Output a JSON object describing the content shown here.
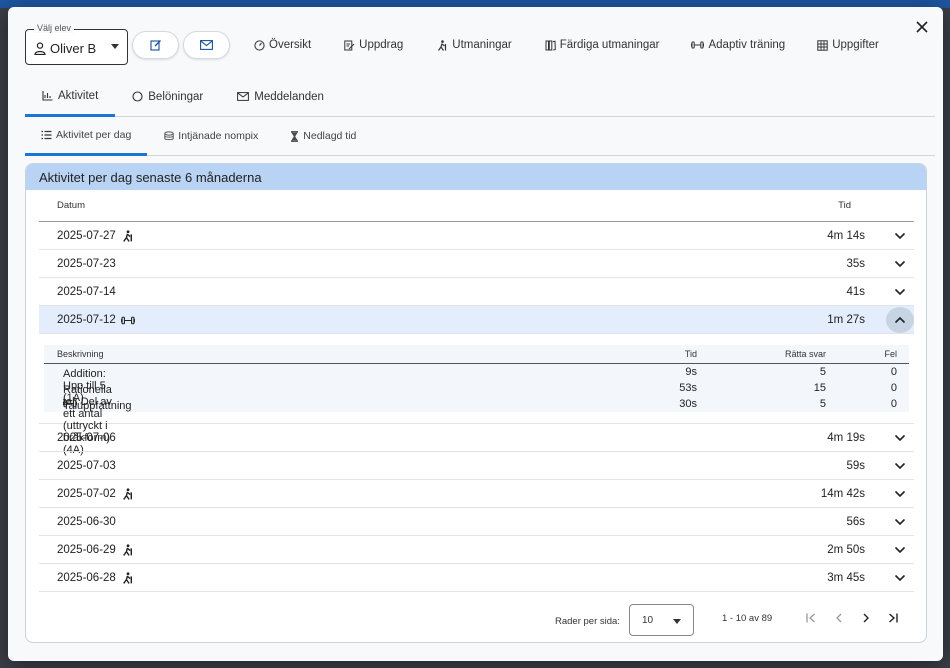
{
  "student_select": {
    "legend": "Välj elev",
    "value": "Oliver B"
  },
  "topnav": [
    {
      "label": "Översikt",
      "icon": "gauge-icon"
    },
    {
      "label": "Uppdrag",
      "icon": "edit-note-icon"
    },
    {
      "label": "Utmaningar",
      "icon": "hiking-icon"
    },
    {
      "label": "Färdiga utmaningar",
      "icon": "books-icon"
    },
    {
      "label": "Adaptiv träning",
      "icon": "dumbbell-icon"
    },
    {
      "label": "Uppgifter",
      "icon": "grid-icon"
    }
  ],
  "tabs": [
    {
      "label": "Aktivitet",
      "icon": "chart-icon",
      "active": true
    },
    {
      "label": "Belöningar",
      "icon": "circle-icon",
      "active": false
    },
    {
      "label": "Meddelanden",
      "icon": "mail-icon",
      "active": false
    }
  ],
  "subtabs": [
    {
      "label": "Aktivitet per dag",
      "icon": "list-icon",
      "active": true
    },
    {
      "label": "Intjänade nompix",
      "icon": "coins-icon",
      "active": false
    },
    {
      "label": "Nedlagd tid",
      "icon": "hourglass-icon",
      "active": false
    }
  ],
  "card": {
    "title": "Aktivitet per dag senaste 6 månaderna"
  },
  "table": {
    "col_date": "Datum",
    "col_time": "Tid",
    "rows": [
      {
        "date": "2025-07-27",
        "icon": "hiking",
        "time": "4m 14s"
      },
      {
        "date": "2025-07-23",
        "icon": "",
        "time": "35s"
      },
      {
        "date": "2025-07-14",
        "icon": "",
        "time": "41s"
      },
      {
        "date": "2025-07-12",
        "icon": "dumbbell",
        "time": "1m 27s",
        "expanded": true
      },
      {
        "date": "2025-07-06",
        "icon": "",
        "time": "4m 19s"
      },
      {
        "date": "2025-07-03",
        "icon": "",
        "time": "59s"
      },
      {
        "date": "2025-07-02",
        "icon": "hiking",
        "time": "14m 42s"
      },
      {
        "date": "2025-06-30",
        "icon": "",
        "time": "56s"
      },
      {
        "date": "2025-06-29",
        "icon": "hiking",
        "time": "2m 50s"
      },
      {
        "date": "2025-06-28",
        "icon": "hiking",
        "time": "3m 45s"
      }
    ]
  },
  "detail": {
    "col_desc": "Beskrivning",
    "col_time": "Tid",
    "col_correct": "Rätta svar",
    "col_wrong": "Fel",
    "rows": [
      {
        "desc": "Addition: Upp till 5 (1A)",
        "icon": "",
        "time": "9s",
        "correct": "5",
        "wrong": "0"
      },
      {
        "desc": "Rationella tal: Del av ett antal (uttryckt i bråkform) (4A)",
        "icon": "",
        "time": "53s",
        "correct": "15",
        "wrong": "0"
      },
      {
        "desc": "Taluppfattning",
        "icon": "dumbbell",
        "time": "30s",
        "correct": "5",
        "wrong": "0"
      }
    ]
  },
  "pager": {
    "rows_label": "Rader per sida:",
    "rows_value": "10",
    "range": "1 - 10 av 89"
  },
  "colors": {
    "accent": "#1976d2",
    "header_bg": "#b9d3f4",
    "expanded_bg": "#e3edfb"
  }
}
